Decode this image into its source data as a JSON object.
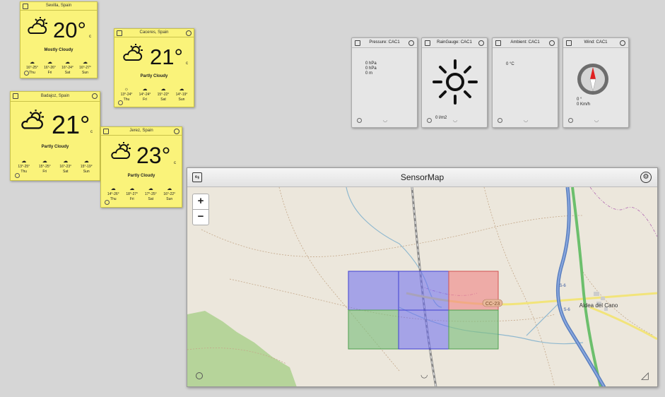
{
  "weather": [
    {
      "city": "Sevilla, Spain",
      "temp": "20°",
      "unit": "c",
      "condition": "Mostly Cloudy",
      "days": [
        {
          "range": "16°-25°",
          "day": "Thu"
        },
        {
          "range": "16°-26°",
          "day": "Fri"
        },
        {
          "range": "16°-24°",
          "day": "Sat"
        },
        {
          "range": "16°-27°",
          "day": "Sun"
        }
      ]
    },
    {
      "city": "Caceres, Spain",
      "temp": "21°",
      "unit": "c",
      "condition": "Partly Cloudy",
      "days": [
        {
          "range": "13°-24°",
          "day": "Thu"
        },
        {
          "range": "14°-24°",
          "day": "Fri"
        },
        {
          "range": "15°-22°",
          "day": "Sat"
        },
        {
          "range": "14°-19°",
          "day": "Sun"
        }
      ]
    },
    {
      "city": "Badajoz, Spain",
      "temp": "21°",
      "unit": "c",
      "condition": "Partly Cloudy",
      "days": [
        {
          "range": "13°-25°",
          "day": "Thu"
        },
        {
          "range": "15°-25°",
          "day": "Fri"
        },
        {
          "range": "16°-23°",
          "day": "Sat"
        },
        {
          "range": "15°-19°",
          "day": "Sun"
        }
      ]
    },
    {
      "city": "Jerez, Spain",
      "temp": "23°",
      "unit": "c",
      "condition": "Partly Cloudy",
      "days": [
        {
          "range": "14°-26°",
          "day": "Thu"
        },
        {
          "range": "18°-27°",
          "day": "Fri"
        },
        {
          "range": "17°-25°",
          "day": "Sat"
        },
        {
          "range": "16°-22°",
          "day": "Sun"
        }
      ]
    }
  ],
  "sensors": {
    "pressure": {
      "title": "Pressure: CAC1",
      "lines": [
        "0 hPa",
        "0 hPa",
        "0 m"
      ]
    },
    "rain": {
      "title": "RainGauge: CAC1",
      "value": "0 l/m2"
    },
    "ambient": {
      "title": "Ambient: CAC1",
      "value": "0 °C"
    },
    "wind": {
      "title": "Wind: CAC1",
      "dir": "0 °",
      "speed": "0 Km/h"
    }
  },
  "map": {
    "title": "SensorMap",
    "zoom_in": "+",
    "zoom_out": "−",
    "labels": {
      "town": "Aldea del Cano",
      "road1": "CC-23",
      "road2": "S-6",
      "road3": "S-6"
    },
    "colors": {
      "blue": "#6b6bf0",
      "red": "#f08a8a",
      "green": "#7fbf7f"
    }
  }
}
